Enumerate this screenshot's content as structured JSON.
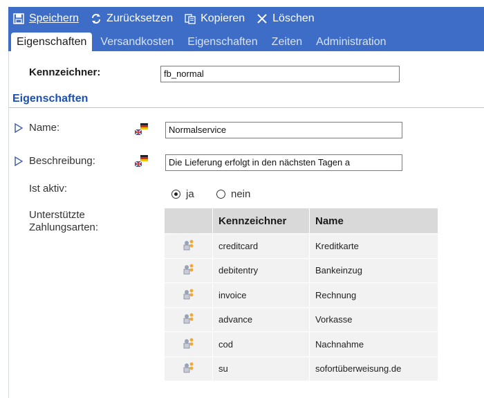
{
  "toolbar": {
    "save": "Speichern",
    "reset": "Zurücksetzen",
    "copy": "Kopieren",
    "delete": "Löschen"
  },
  "tabs": [
    "Eigenschaften",
    "Versandkosten",
    "Eigenschaften",
    "Zeiten",
    "Administration"
  ],
  "form": {
    "identifier_label": "Kennzeichner:",
    "identifier_value": "fb_normal",
    "section_title": "Eigenschaften",
    "name_label": "Name:",
    "name_value": "Normalservice",
    "description_label": "Beschreibung:",
    "description_value": "Die Lieferung erfolgt in den nächsten Tagen a",
    "active_label": "Ist aktiv:",
    "active_yes": "ja",
    "active_no": "nein",
    "active_selected": "ja",
    "payment_label": "Unterstützte Zahlungsarten:"
  },
  "payments": {
    "headers": [
      "Kennzeichner",
      "Name"
    ],
    "rows": [
      {
        "code": "creditcard",
        "name": "Kreditkarte"
      },
      {
        "code": "debitentry",
        "name": "Bankeinzug"
      },
      {
        "code": "invoice",
        "name": "Rechnung"
      },
      {
        "code": "advance",
        "name": "Vorkasse"
      },
      {
        "code": "cod",
        "name": "Nachnahme"
      },
      {
        "code": "su",
        "name": "sofortüberweisung.de"
      }
    ]
  },
  "colors": {
    "toolbar_bg": "#3d6dc7",
    "section_title": "#1a4fb5"
  }
}
